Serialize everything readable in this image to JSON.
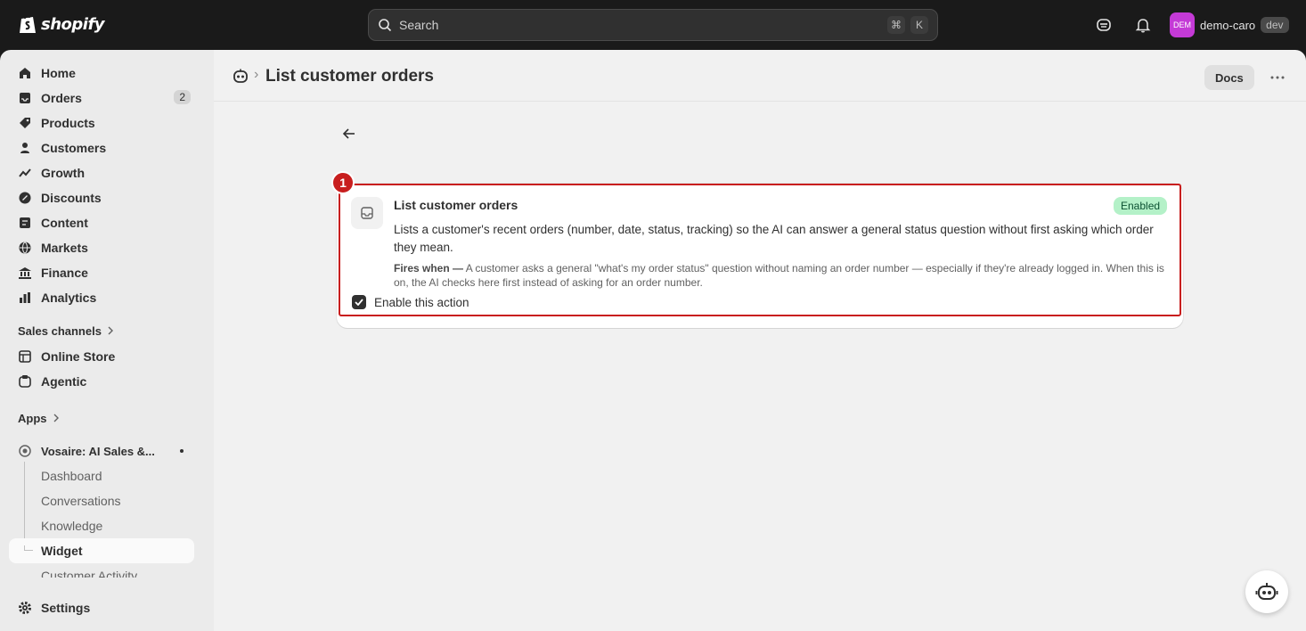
{
  "topbar": {
    "logo_text": "shopify",
    "search_placeholder": "Search",
    "shortcut_keys": [
      "⌘",
      "K"
    ],
    "store_avatar": "DEM",
    "store_name": "demo-caro",
    "env_badge": "dev"
  },
  "sidebar": {
    "items": [
      {
        "label": "Home",
        "icon": "home-icon"
      },
      {
        "label": "Orders",
        "icon": "inbox-icon",
        "count": "2"
      },
      {
        "label": "Products",
        "icon": "tag-icon"
      },
      {
        "label": "Customers",
        "icon": "person-icon"
      },
      {
        "label": "Growth",
        "icon": "growth-icon"
      },
      {
        "label": "Discounts",
        "icon": "discount-icon"
      },
      {
        "label": "Content",
        "icon": "content-icon"
      },
      {
        "label": "Markets",
        "icon": "globe-icon"
      },
      {
        "label": "Finance",
        "icon": "bank-icon"
      },
      {
        "label": "Analytics",
        "icon": "bar-chart-icon"
      }
    ],
    "sales_channels_label": "Sales channels",
    "channels": [
      {
        "label": "Online Store",
        "icon": "store-icon"
      },
      {
        "label": "Agentic",
        "icon": "agentic-icon"
      }
    ],
    "apps_label": "Apps",
    "app_name": "Vosaire: AI Sales &...",
    "app_subitems": [
      "Dashboard",
      "Conversations",
      "Knowledge",
      "Widget",
      "Customer Activity"
    ],
    "settings_label": "Settings"
  },
  "header": {
    "title": "List customer orders",
    "docs_label": "Docs"
  },
  "action_card": {
    "marker": "1",
    "title": "List customer orders",
    "status": "Enabled",
    "description": "Lists a customer's recent orders (number, date, status, tracking) so the AI can answer a general status question without first asking which order they mean.",
    "fires_label": "Fires when —",
    "fires_text": "A customer asks a general \"what's my order status\" question without naming an order number — especially if they're already logged in. When this is on, the AI checks here first instead of asking for an order number.",
    "enable_label": "Enable this action",
    "enabled": true
  },
  "colors": {
    "highlight": "#c81e1e",
    "enabled_badge_bg": "#b4f1c8",
    "avatar_bg": "#c43ad6"
  }
}
